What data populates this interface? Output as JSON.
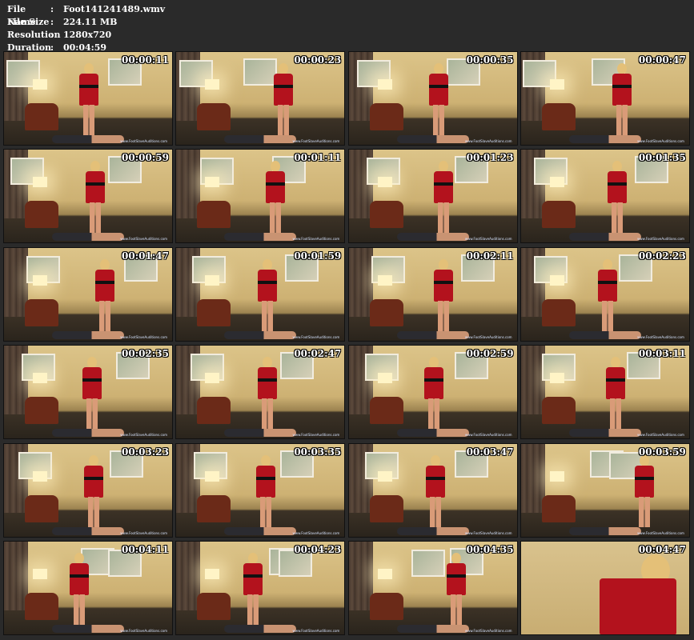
{
  "file_info": [
    {
      "label": "File Name",
      "sep": ":",
      "value": "Foot141241489.wmv"
    },
    {
      "label": "File Size",
      "sep": ":",
      "value": "224.11 MB"
    },
    {
      "label": "Resolution",
      "sep": ":",
      "value": "1280x720"
    },
    {
      "label": "Duration",
      "sep": ":",
      "value": "00:04:59"
    }
  ],
  "watermark": "www.FootSlaveAuditions.com",
  "thumbnails": [
    {
      "time": "00:00:11"
    },
    {
      "time": "00:00:23"
    },
    {
      "time": "00:00:35"
    },
    {
      "time": "00:00:47"
    },
    {
      "time": "00:00:59"
    },
    {
      "time": "00:01:11"
    },
    {
      "time": "00:01:23"
    },
    {
      "time": "00:01:35"
    },
    {
      "time": "00:01:47"
    },
    {
      "time": "00:01:59"
    },
    {
      "time": "00:02:11"
    },
    {
      "time": "00:02:23"
    },
    {
      "time": "00:02:35"
    },
    {
      "time": "00:02:47"
    },
    {
      "time": "00:02:59"
    },
    {
      "time": "00:03:11"
    },
    {
      "time": "00:03:23"
    },
    {
      "time": "00:03:35"
    },
    {
      "time": "00:03:47"
    },
    {
      "time": "00:03:59"
    },
    {
      "time": "00:04:11"
    },
    {
      "time": "00:04:23"
    },
    {
      "time": "00:04:35"
    },
    {
      "time": "00:04:47",
      "closeup": true
    }
  ]
}
